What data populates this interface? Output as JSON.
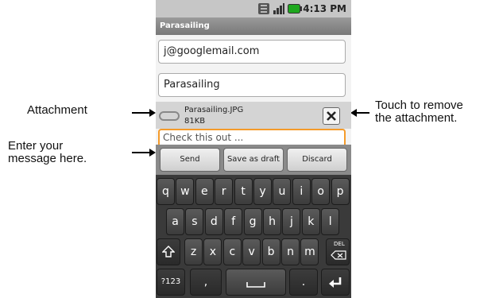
{
  "callouts": {
    "attachment": "Attachment",
    "enter_message_line1": "Enter your",
    "enter_message_line2": "message here.",
    "remove_line1": "Touch to remove",
    "remove_line2": "the attachment."
  },
  "status_bar": {
    "time": "4:13 PM",
    "icons": [
      "network-3g-icon",
      "signal-bars-icon",
      "battery-icon"
    ],
    "battery_color": "#1ea81e"
  },
  "app": {
    "title": "Parasailing"
  },
  "compose": {
    "to_value": "j@googlemail.com",
    "subject_value": "Parasailing",
    "attachment": {
      "filename": "Parasailing.JPG",
      "size": "81KB"
    },
    "body_placeholder": "Check this out ...",
    "body_focus_color": "#f59b2a"
  },
  "actions": {
    "send": "Send",
    "save_draft": "Save as draft",
    "discard": "Discard"
  },
  "keyboard": {
    "row1": [
      "q",
      "w",
      "e",
      "r",
      "t",
      "y",
      "u",
      "i",
      "o",
      "p"
    ],
    "row2": [
      "a",
      "s",
      "d",
      "f",
      "g",
      "h",
      "j",
      "k",
      "l"
    ],
    "row3": [
      "z",
      "x",
      "c",
      "v",
      "b",
      "n",
      "m"
    ],
    "symbols_key": "?123",
    "comma_key": ",",
    "period_key": ".",
    "del_label": "DEL"
  }
}
